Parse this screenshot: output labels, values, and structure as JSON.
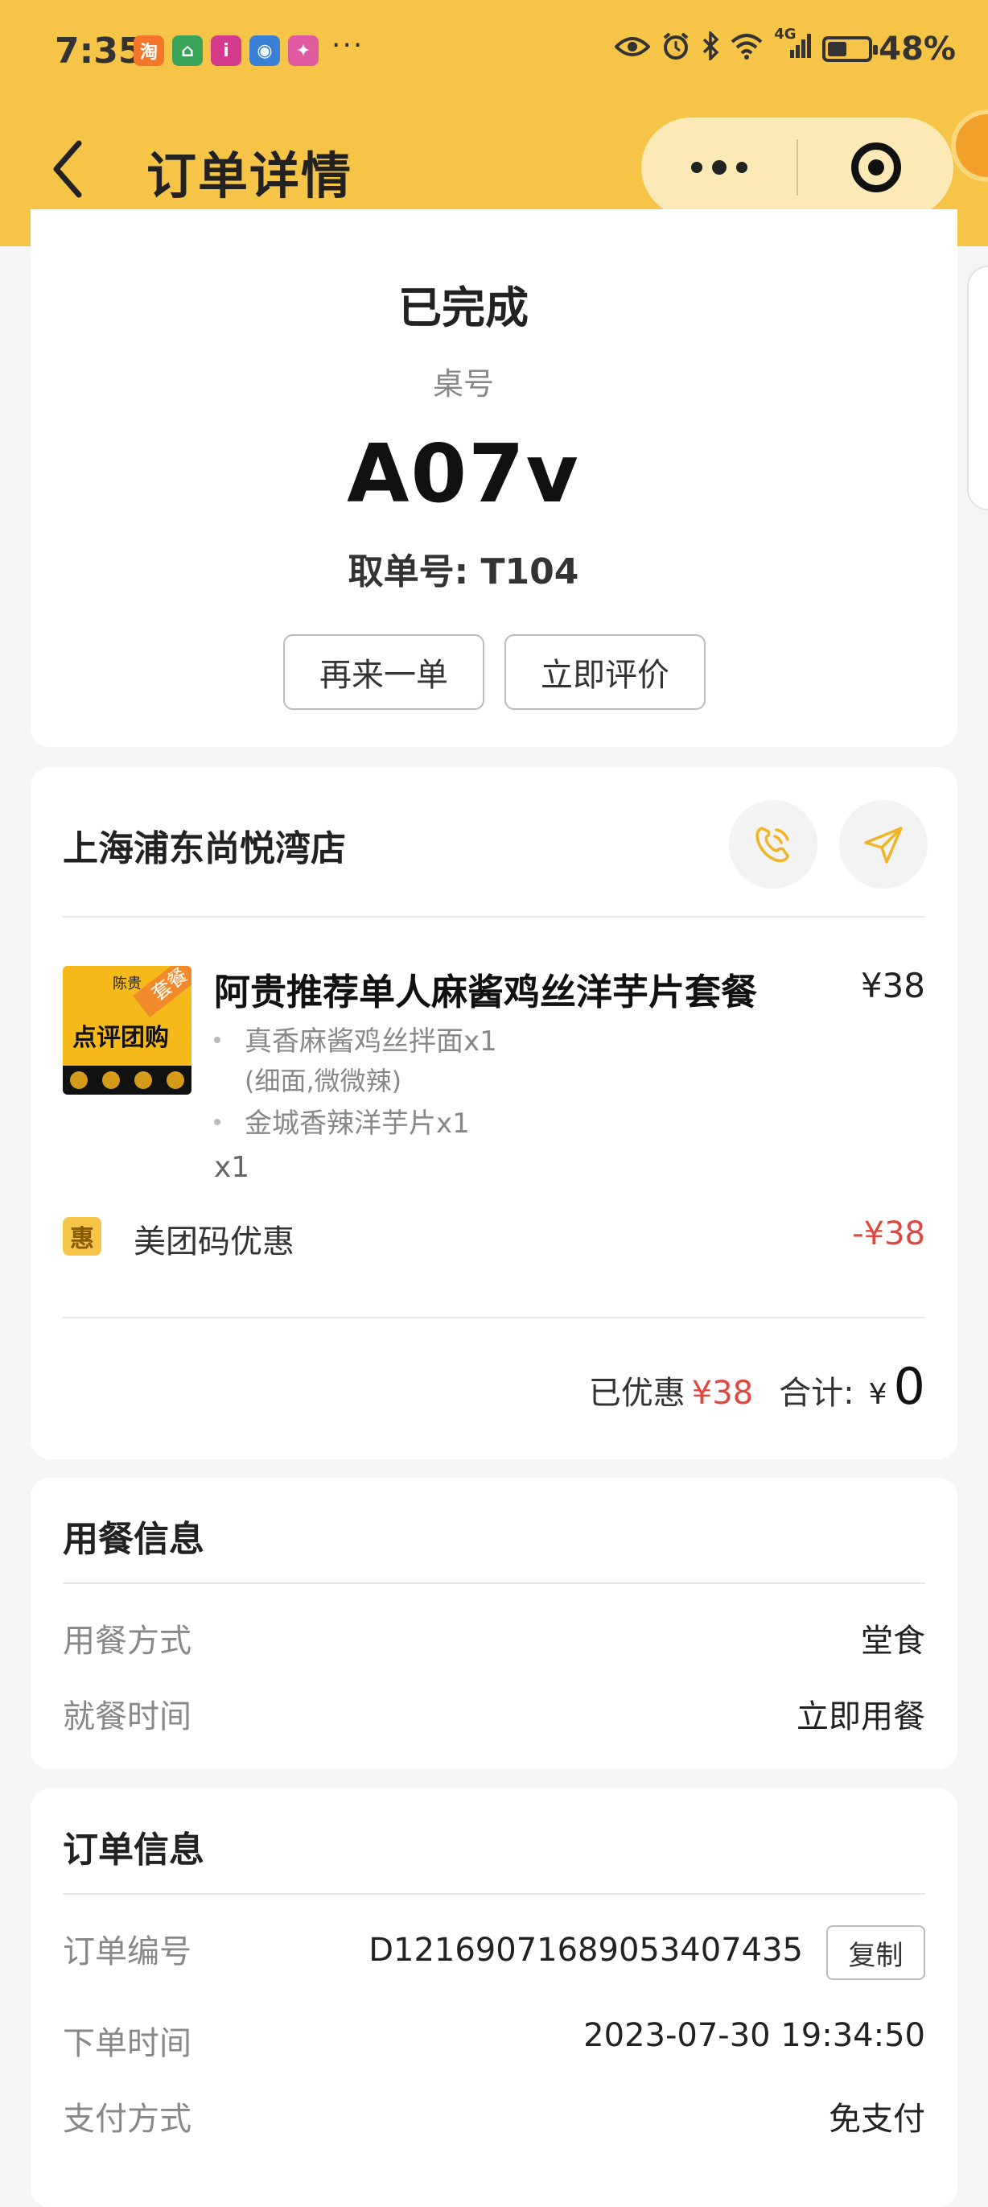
{
  "status_bar": {
    "time": "7:35",
    "app_icons": [
      {
        "name": "taobao-icon",
        "glyph": "淘",
        "color": "#f4762a"
      },
      {
        "name": "home-app-icon",
        "glyph": "⌂",
        "color": "#3aa35a"
      },
      {
        "name": "info-app-icon",
        "glyph": "i",
        "color": "#d63a8a"
      },
      {
        "name": "globe-app-icon",
        "glyph": "◉",
        "color": "#3a7fd6"
      },
      {
        "name": "colorful-app-icon",
        "glyph": "✦",
        "color": "#e05aa0"
      }
    ],
    "more": "···",
    "network": "4G",
    "battery": "48%",
    "battery_level": 0.48
  },
  "header": {
    "title": "订单详情"
  },
  "order_status": {
    "status": "已完成",
    "table_label": "桌号",
    "table_number": "A07v",
    "pickup": "取单号: T104",
    "reorder_button": "再来一单",
    "review_button": "立即评价"
  },
  "store": {
    "name": "上海浦东尚悦湾店",
    "item": {
      "image_top": "陈贵",
      "image_text": "点评团购",
      "image_tag": "套餐",
      "title": "阿贵推荐单人麻酱鸡丝洋芋片套餐",
      "price": "¥38",
      "sub1": "真香麻酱鸡丝拌面x1",
      "sub1_note": "(细面,微微辣)",
      "sub2": "金城香辣洋芋片x1",
      "qty": "x1"
    },
    "promo": {
      "badge": "惠",
      "label": "美团码优惠",
      "amount": "-¥38"
    },
    "totals": {
      "discount_label": "已优惠",
      "discount_amount": "¥38",
      "total_label": "合计:",
      "yen": "¥",
      "total_amount": "0"
    }
  },
  "dining_info": {
    "title": "用餐信息",
    "rows": [
      {
        "label": "用餐方式",
        "value": "堂食"
      },
      {
        "label": "就餐时间",
        "value": "立即用餐"
      }
    ]
  },
  "order_info": {
    "title": "订单信息",
    "rows": [
      {
        "label": "订单编号",
        "value": "D12169071689053407435"
      },
      {
        "label": "下单时间",
        "value": "2023-07-30 19:34:50"
      },
      {
        "label": "支付方式",
        "value": "免支付"
      }
    ],
    "copy_button": "复制"
  },
  "colors": {
    "header_bg": "#f6c447",
    "accent_red": "#e0473e",
    "nav_icon": "#f0b429"
  }
}
